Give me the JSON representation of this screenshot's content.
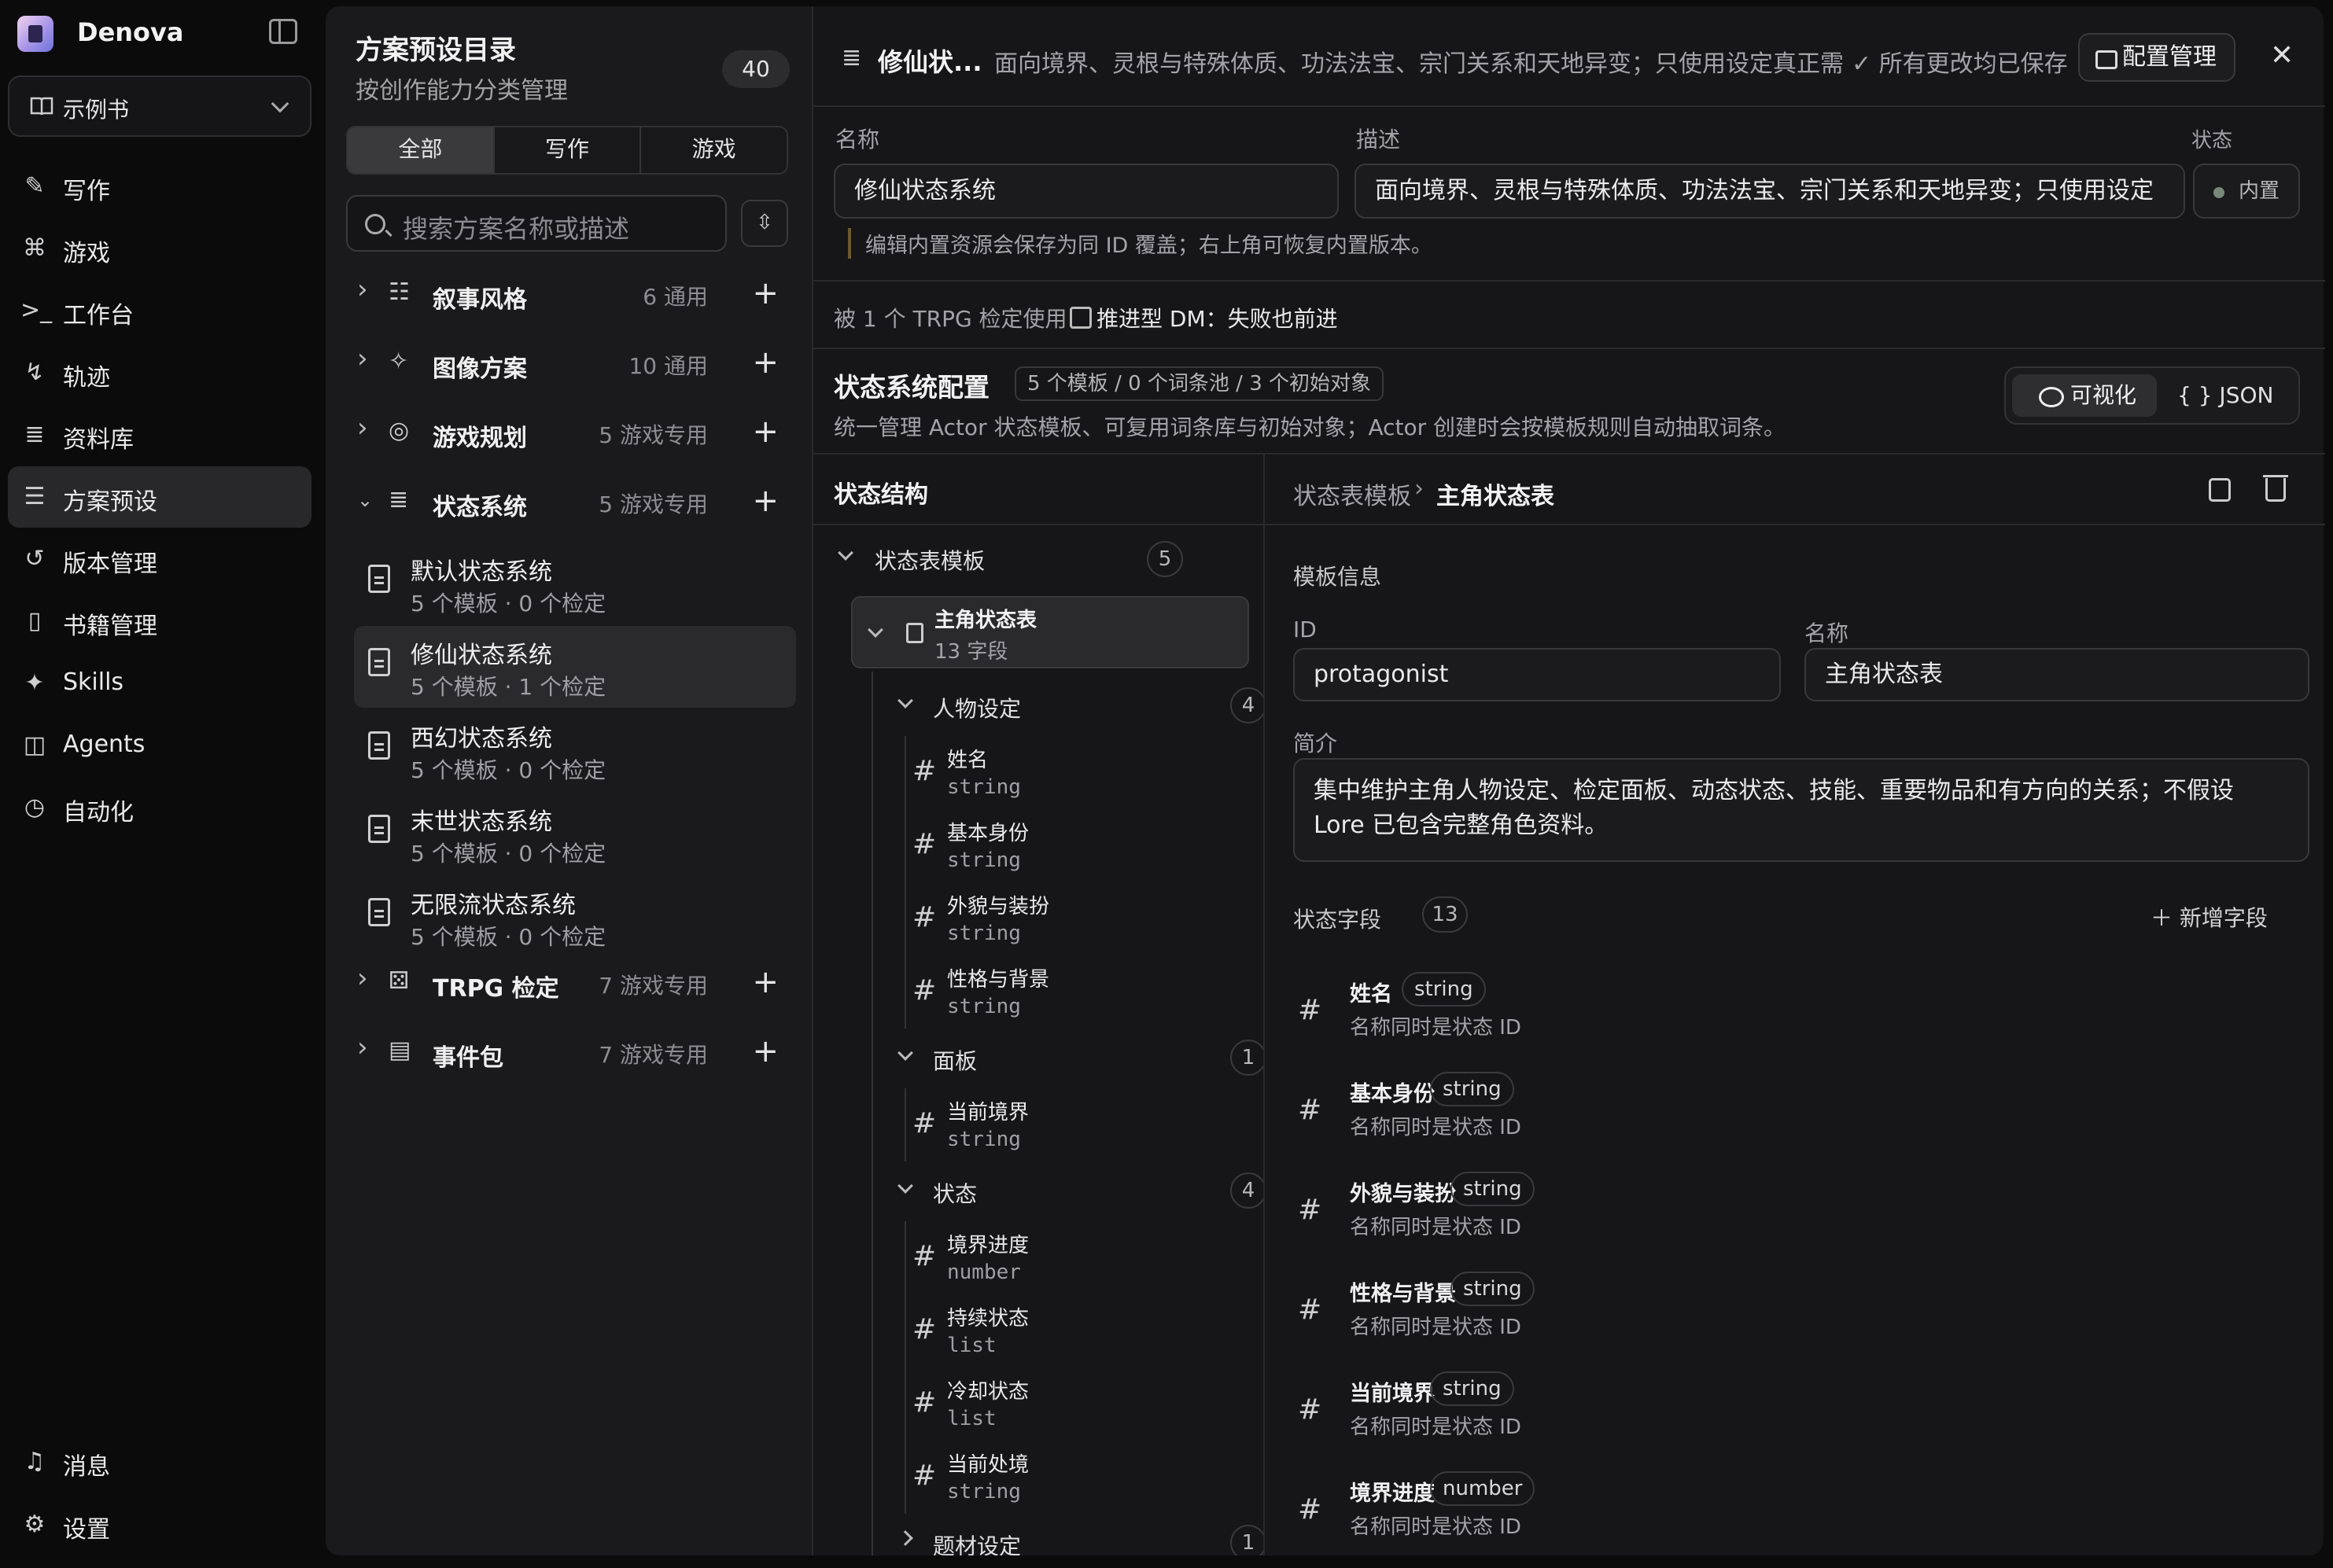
{
  "app": {
    "name": "Denova"
  },
  "book_select": {
    "value": "示例书"
  },
  "nav": [
    {
      "label": "写作",
      "icon": "pen-icon",
      "glyph": "✎"
    },
    {
      "label": "游戏",
      "icon": "gamepad-icon",
      "glyph": "⌘"
    },
    {
      "label": "工作台",
      "icon": "terminal-icon",
      "glyph": ">_"
    },
    {
      "label": "轨迹",
      "icon": "route-icon",
      "glyph": "↯"
    },
    {
      "label": "资料库",
      "icon": "database-icon",
      "glyph": "≣"
    },
    {
      "label": "方案预设",
      "icon": "sliders-icon",
      "glyph": "☰",
      "active": true
    },
    {
      "label": "版本管理",
      "icon": "history-icon",
      "glyph": "↺"
    },
    {
      "label": "书籍管理",
      "icon": "book-icon",
      "glyph": "▯"
    },
    {
      "label": "Skills",
      "icon": "sparkles-icon",
      "glyph": "✦"
    },
    {
      "label": "Agents",
      "icon": "bot-icon",
      "glyph": "◫"
    },
    {
      "label": "自动化",
      "icon": "clock-icon",
      "glyph": "◷"
    }
  ],
  "nav_bottom": [
    {
      "label": "消息",
      "icon": "bell-icon",
      "glyph": "♫"
    },
    {
      "label": "设置",
      "icon": "gear-icon",
      "glyph": "⚙"
    }
  ],
  "catalog": {
    "title": "方案预设目录",
    "subtitle": "按创作能力分类管理",
    "count": "40",
    "filters": [
      "全部",
      "写作",
      "游戏"
    ],
    "active_filter": "全部",
    "search_placeholder": "搜索方案名称或描述",
    "categories": [
      {
        "name": "叙事风格",
        "meta": "6 通用",
        "glyph": "☷",
        "expanded": false
      },
      {
        "name": "图像方案",
        "meta": "10 通用",
        "glyph": "✧",
        "expanded": false
      },
      {
        "name": "游戏规划",
        "meta": "5 游戏专用",
        "glyph": "◎",
        "expanded": false
      },
      {
        "name": "状态系统",
        "meta": "5 游戏专用",
        "glyph": "≣",
        "expanded": true
      },
      {
        "name": "TRPG 检定",
        "meta": "7 游戏专用",
        "glyph": "⚄",
        "expanded": false
      },
      {
        "name": "事件包",
        "meta": "7 游戏专用",
        "glyph": "▤",
        "expanded": false
      }
    ],
    "presets": [
      {
        "name": "默认状态系统",
        "meta": "5 个模板 · 0 个检定"
      },
      {
        "name": "修仙状态系统",
        "meta": "5 个模板 · 1 个检定",
        "selected": true
      },
      {
        "name": "西幻状态系统",
        "meta": "5 个模板 · 0 个检定"
      },
      {
        "name": "末世状态系统",
        "meta": "5 个模板 · 0 个检定"
      },
      {
        "name": "无限流状态系统",
        "meta": "5 个模板 · 0 个检定"
      }
    ]
  },
  "topbar": {
    "title": "修仙状...",
    "desc": "面向境界、灵根与特殊体质、功法法宝、宗门关系和天地异变；只使用设定真正需...",
    "saved": "所有更改均已保存",
    "config_button": "配置管理"
  },
  "form": {
    "name_label": "名称",
    "name_value": "修仙状态系统",
    "desc_label": "描述",
    "desc_value": "面向境界、灵根与特殊体质、功法法宝、宗门关系和天地异变；只使用设定",
    "status_label": "状态",
    "status_value": "内置",
    "note": "编辑内置资源会保存为同 ID 覆盖；右上角可恢复内置版本。"
  },
  "usage": {
    "used_by": "被 1 个 TRPG 检定使用",
    "dm": "推进型 DM：失败也前进"
  },
  "config": {
    "title": "状态系统配置",
    "pill": "5 个模板 / 0 个词条池 / 3 个初始对象",
    "desc": "统一管理 Actor 状态模板、可复用词条库与初始对象；Actor 创建时会按模板规则自动抽取词条。",
    "view_visual": "可视化",
    "view_json": "{ } JSON"
  },
  "tree": {
    "header": "状态结构",
    "root": {
      "label": "状态表模板",
      "count": "5"
    },
    "template": {
      "name": "主角状态表",
      "meta": "13 字段"
    },
    "groups": [
      {
        "label": "人物设定",
        "count": "4",
        "fields": [
          {
            "name": "姓名",
            "type": "string"
          },
          {
            "name": "基本身份",
            "type": "string"
          },
          {
            "name": "外貌与装扮",
            "type": "string"
          },
          {
            "name": "性格与背景",
            "type": "string"
          }
        ]
      },
      {
        "label": "面板",
        "count": "1",
        "fields": [
          {
            "name": "当前境界",
            "type": "string"
          }
        ]
      },
      {
        "label": "状态",
        "count": "4",
        "fields": [
          {
            "name": "境界进度",
            "type": "number"
          },
          {
            "name": "持续状态",
            "type": "list"
          },
          {
            "name": "冷却状态",
            "type": "list"
          },
          {
            "name": "当前处境",
            "type": "string"
          }
        ]
      },
      {
        "label": "题材设定",
        "count": "1",
        "fields": []
      }
    ]
  },
  "detail": {
    "crumb_parent": "状态表模板",
    "crumb_current": "主角状态表",
    "section": "模板信息",
    "id_label": "ID",
    "id_value": "protagonist",
    "name_label": "名称",
    "name_value": "主角状态表",
    "intro_label": "简介",
    "intro_value": "集中维护主角人物设定、检定面板、动态状态、技能、重要物品和有方向的关系；不假设 Lore 已包含完整角色资料。",
    "fields_label": "状态字段",
    "fields_count": "13",
    "add_field": "新增字段",
    "fields": [
      {
        "name": "姓名",
        "type": "string",
        "desc": "名称同时是状态 ID"
      },
      {
        "name": "基本身份",
        "type": "string",
        "desc": "名称同时是状态 ID"
      },
      {
        "name": "外貌与装扮",
        "type": "string",
        "desc": "名称同时是状态 ID"
      },
      {
        "name": "性格与背景",
        "type": "string",
        "desc": "名称同时是状态 ID"
      },
      {
        "name": "当前境界",
        "type": "string",
        "desc": "名称同时是状态 ID"
      },
      {
        "name": "境界进度",
        "type": "number",
        "desc": "名称同时是状态 ID"
      }
    ]
  }
}
